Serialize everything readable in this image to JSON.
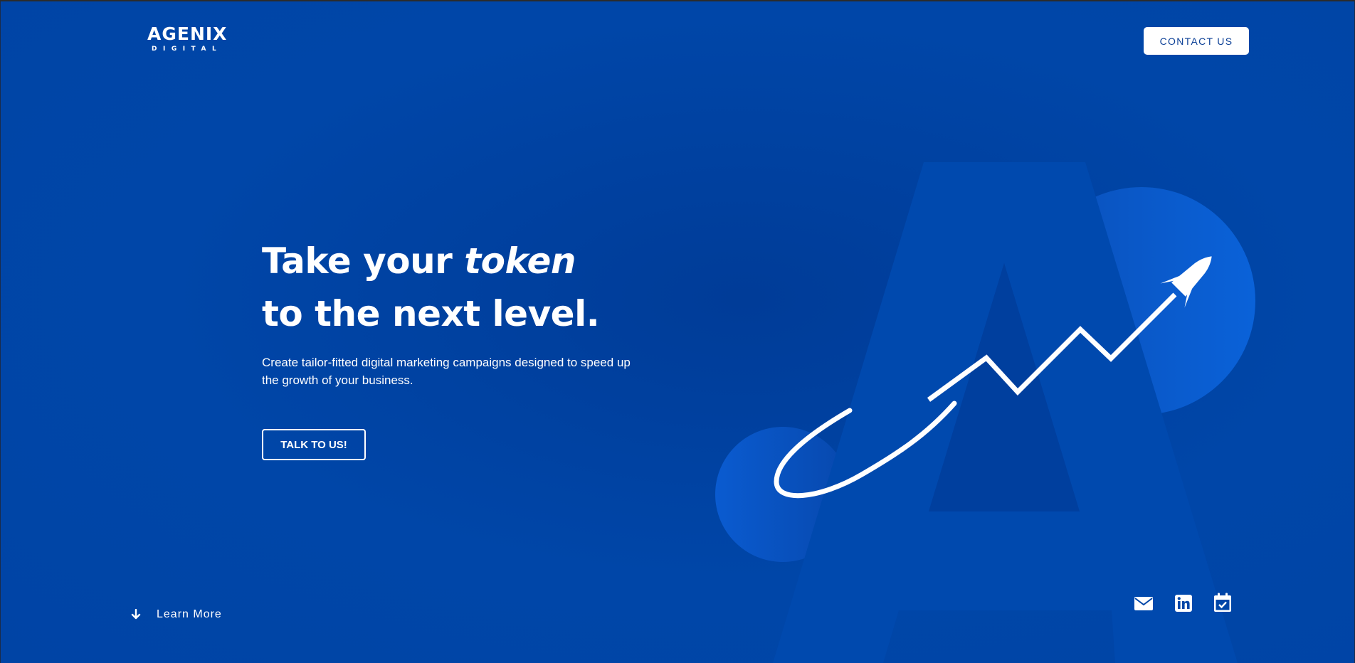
{
  "brand": {
    "name": "AGENIX",
    "tagline": "DIGITAL"
  },
  "header": {
    "contact_label": "CONTACT US"
  },
  "hero": {
    "headline_part1": "Take your ",
    "headline_emphasis": "token",
    "headline_line2": "to the next level.",
    "subtext": "Create tailor-fitted digital marketing campaigns designed to speed up the growth of your business.",
    "cta_label": "TALK TO US!"
  },
  "footer": {
    "learn_more_label": "Learn More",
    "social_icons": [
      "mail-icon",
      "linkedin-icon",
      "calendar-check-icon"
    ]
  },
  "colors": {
    "background": "#0046a8",
    "accent_circle": "#0a5fd6",
    "button_text": "#0b3f96",
    "white": "#ffffff"
  }
}
